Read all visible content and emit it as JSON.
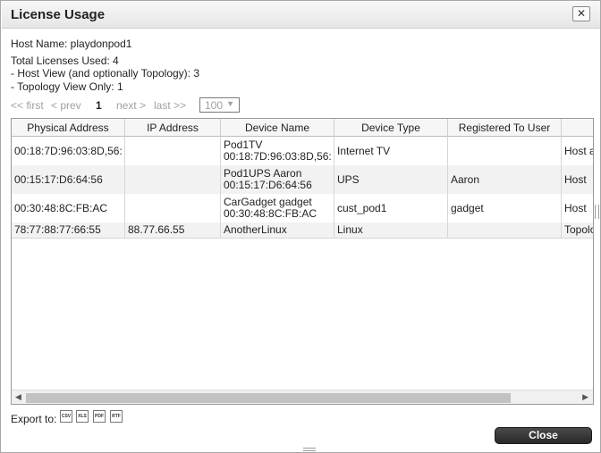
{
  "dialog": {
    "title": "License Usage",
    "close_glyph": "✕"
  },
  "info": {
    "host_name": "Host Name: playdonpod1",
    "total": "Total Licenses Used: 4",
    "host_view": "- Host View (and optionally Topology): 3",
    "topology_only": "- Topology View Only: 1"
  },
  "pager": {
    "first": "<< first",
    "prev": "< prev",
    "current": "1",
    "next": "next >",
    "last": "last >>",
    "page_size": "100"
  },
  "table": {
    "columns": [
      "Physical Address",
      "IP Address",
      "Device Name",
      "Device Type",
      "Registered To User",
      ""
    ],
    "rows": [
      {
        "physical": "00:18:7D:96:03:8D,56:",
        "ip": "",
        "name1": "Pod1TV",
        "name2": "00:18:7D:96:03:8D,56:",
        "type": "Internet TV",
        "user": "",
        "view": "Host a"
      },
      {
        "physical": "00:15:17:D6:64:56",
        "ip": "",
        "name1": "Pod1UPS Aaron",
        "name2": "00:15:17:D6:64:56",
        "type": "UPS",
        "user": "Aaron",
        "view": "Host"
      },
      {
        "physical": "00:30:48:8C:FB:AC",
        "ip": "",
        "name1": "CarGadget gadget",
        "name2": "00:30:48:8C:FB:AC",
        "type": "cust_pod1",
        "user": "gadget",
        "view": "Host"
      },
      {
        "physical": "78:77:88:77:66:55",
        "ip": "88.77.66.55",
        "name1": "AnotherLinux",
        "name2": "",
        "type": "Linux",
        "user": "",
        "view": "Topolo"
      }
    ]
  },
  "export": {
    "label": "Export to:",
    "formats": [
      "CSV",
      "XLS",
      "PDF",
      "RTF"
    ]
  },
  "buttons": {
    "close": "Close"
  }
}
